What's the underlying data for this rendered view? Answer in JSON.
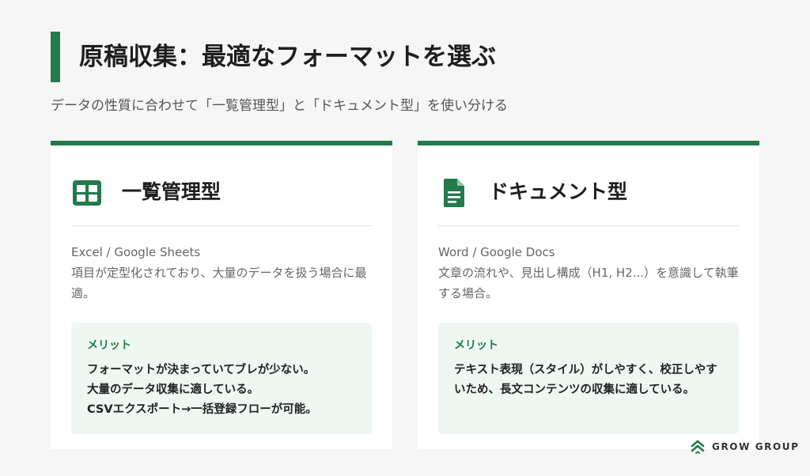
{
  "page": {
    "title": "原稿収集：最適なフォーマットを選ぶ",
    "subtitle": "データの性質に合わせて「一覧管理型」と「ドキュメント型」を使い分ける"
  },
  "cards": [
    {
      "icon": "spreadsheet-icon",
      "title": "一覧管理型",
      "tools": "Excel / Google Sheets",
      "description": "項目が定型化されており、大量のデータを扱う場合に最適。",
      "merit_label": "メリット",
      "merits": [
        "フォーマットが決まっていてブレが少ない。",
        "大量のデータ収集に適している。",
        "CSVエクスポート→一括登録フローが可能。"
      ]
    },
    {
      "icon": "document-icon",
      "title": "ドキュメント型",
      "tools": "Word / Google Docs",
      "description": "文章の流れや、見出し構成（H1, H2...）を意識して執筆する場合。",
      "merit_label": "メリット",
      "merits": [
        "テキスト表現（スタイル）がしやすく、校正しやすいため、長文コンテンツの収集に適している。"
      ]
    }
  ],
  "logo": {
    "text": "GROW GROUP"
  },
  "colors": {
    "accent": "#237a4a",
    "merit_bg": "#eef7f1",
    "background": "#f6f6f6"
  }
}
